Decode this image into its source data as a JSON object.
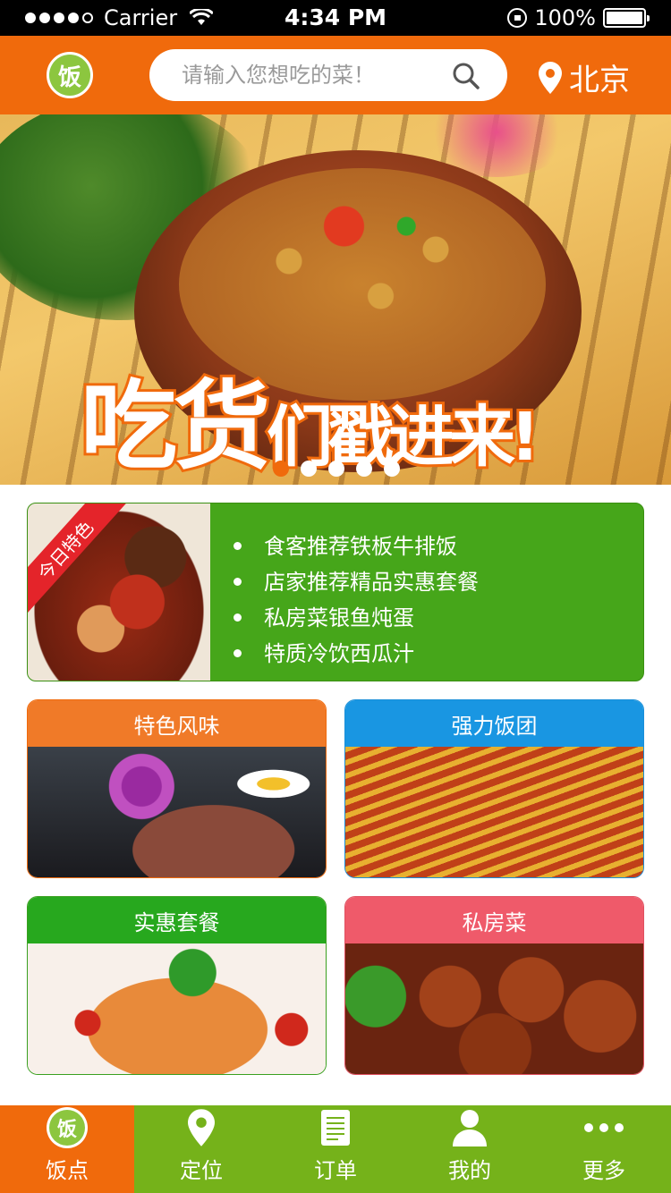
{
  "status_bar": {
    "carrier": "Carrier",
    "time": "4:34 PM",
    "battery": "100%"
  },
  "header": {
    "logo_text": "饭",
    "search_placeholder": "请输入您想吃的菜！",
    "location": "北京"
  },
  "banner": {
    "title_main": "吃货",
    "title_tail": "们戳进来!",
    "slides": 5,
    "active_slide": 1
  },
  "today_special": {
    "badge": "今日特色",
    "items": [
      "食客推荐铁板牛排饭",
      "店家推荐精品实惠套餐",
      "私房菜银鱼炖蛋",
      "特质冷饮西瓜汁"
    ]
  },
  "categories": [
    {
      "label": "特色风味",
      "color": "#f07a28"
    },
    {
      "label": "强力饭团",
      "color": "#1996e2"
    },
    {
      "label": "实惠套餐",
      "color": "#27a81e"
    },
    {
      "label": "私房菜",
      "color": "#ef5a6a"
    }
  ],
  "tabbar": {
    "items": [
      {
        "label": "饭点",
        "icon": "logo-icon",
        "active": true
      },
      {
        "label": "定位",
        "icon": "location-pin-icon",
        "active": false
      },
      {
        "label": "订单",
        "icon": "document-icon",
        "active": false
      },
      {
        "label": "我的",
        "icon": "person-icon",
        "active": false
      },
      {
        "label": "更多",
        "icon": "more-dots-icon",
        "active": false
      }
    ]
  },
  "colors": {
    "primary_orange": "#f06a0c",
    "tabbar_green": "#75b21a",
    "special_green": "#46a61a"
  }
}
